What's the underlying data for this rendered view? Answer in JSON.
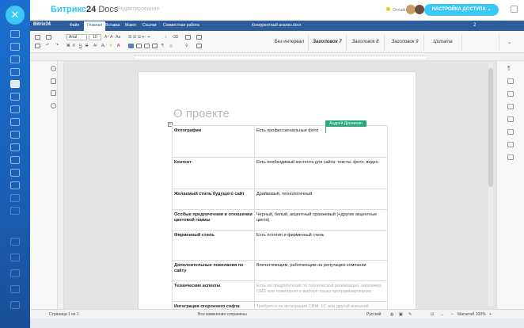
{
  "app": {
    "brand_name": "Битрикс",
    "brand_num": "24",
    "brand_suffix": " Docs",
    "brand_sub": "Редактирование",
    "online_label": "Онлайн",
    "access_button": "НАСТРОЙКА ДОСТУПА",
    "accent": "#3bc8f5"
  },
  "menubar": {
    "logo": "Bitrix24",
    "tabs": [
      "Файл",
      "Главная",
      "Вставка",
      "Макет",
      "Ссылки",
      "Совместная работа"
    ],
    "active_tab": "Главная",
    "doc_title": "Конкурентный анализ.docx",
    "users_count": "2"
  },
  "toolbar": {
    "font": "Arial",
    "font_size": "10",
    "styles": [
      "Без интервал",
      "Заголовок 7",
      "Заголовок 8",
      "Заголовок 9",
      "Цитата"
    ]
  },
  "document": {
    "heading": "О проекте",
    "cursor_user": "Андрей Дружинин",
    "rows": [
      {
        "label": "Фотографии",
        "value": "Есть профессиональные фото",
        "muted": false
      },
      {
        "label": "Контент",
        "value": "Есть необходимый контента для сайта: тексты, фото, видео.",
        "muted": false
      },
      {
        "label": "Желаемый стиль будущего сайт",
        "value": "Драйвовый, технологичный",
        "muted": false
      },
      {
        "label": "Особые предпочтения в отношении цветовой гаммы",
        "value": "Черный, белый, акцентный оранжевый (+другие акцентные цвета)",
        "muted": false
      },
      {
        "label": "Фирменный стиль",
        "value": "Есть логотип и фирменный стиль",
        "muted": false
      },
      {
        "label": "Дополнительные пожелания по сайту",
        "value": "Впечатляющим, работающим на репутацию компании",
        "muted": false
      },
      {
        "label": "Технические аспекты",
        "value": "Есть ли предпочтения по технической реализации, например, CMS или пожелания в выборе языка программирования",
        "muted": true
      },
      {
        "label": "Интеграция стороннего софта",
        "value": "Требуется ли интеграция CRM, 1С или другой внешней",
        "muted": true
      }
    ]
  },
  "statusbar": {
    "page": "Страница 1 из 1",
    "saved": "Все изменения сохранены",
    "language": "Русский",
    "zoom": "Масштаб 100%"
  }
}
